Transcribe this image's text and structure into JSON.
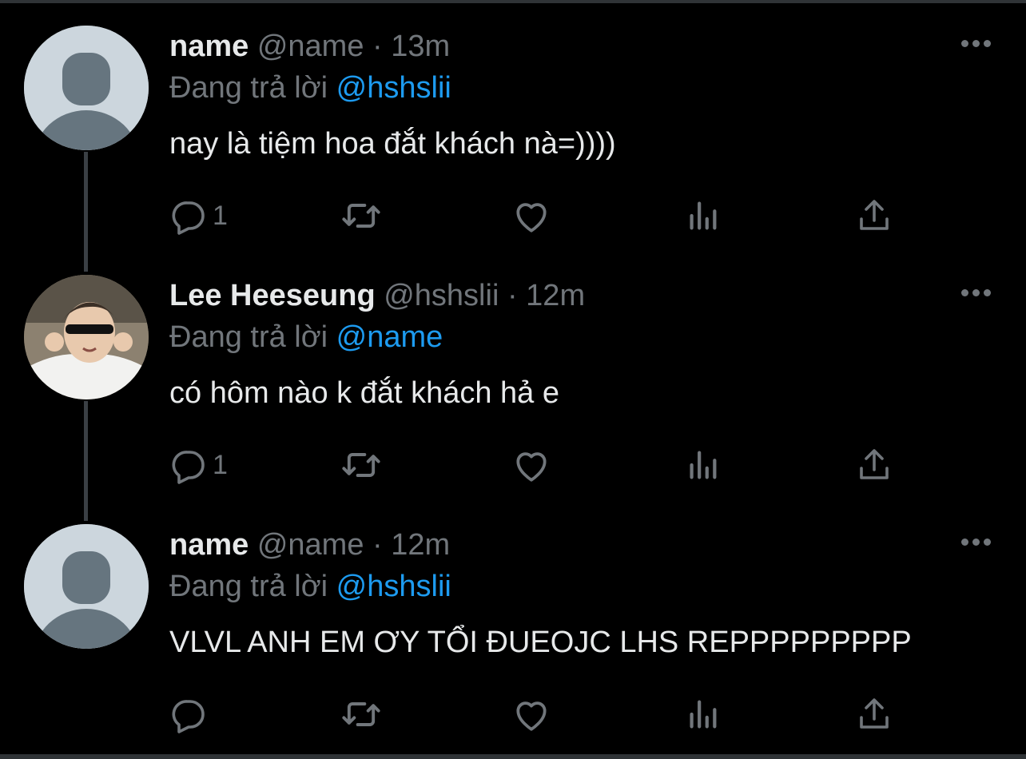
{
  "tweets": [
    {
      "display_name": "name",
      "handle": "@name",
      "separator": "·",
      "time": "13m",
      "reply_prefix": "Đang trả lời",
      "reply_to": "@hshslii",
      "text": "nay là tiệm hoa đắt khách nà=))))",
      "reply_count": "1",
      "avatar": "default-avatar"
    },
    {
      "display_name": "Lee Heeseung",
      "handle": "@hshslii",
      "separator": "·",
      "time": "12m",
      "reply_prefix": "Đang trả lời",
      "reply_to": "@name",
      "text": "có hôm nào k đắt khách hả e",
      "reply_count": "1",
      "avatar": "photo-avatar"
    },
    {
      "display_name": "name",
      "handle": "@name",
      "separator": "·",
      "time": "12m",
      "reply_prefix": "Đang trả lời",
      "reply_to": "@hshslii",
      "text": "VLVL ANH EM ƠY TỔI ĐUEOJC LHS REPPPPPPPPP",
      "reply_count": "",
      "avatar": "default-avatar"
    }
  ],
  "icons": {
    "reply": "reply-icon",
    "retweet": "retweet-icon",
    "like": "like-icon",
    "analytics": "analytics-icon",
    "share": "share-icon",
    "more": "more-icon"
  },
  "colors": {
    "background": "#000000",
    "text": "#e7e9ea",
    "secondary": "#71767b",
    "link": "#1d9bf0"
  }
}
